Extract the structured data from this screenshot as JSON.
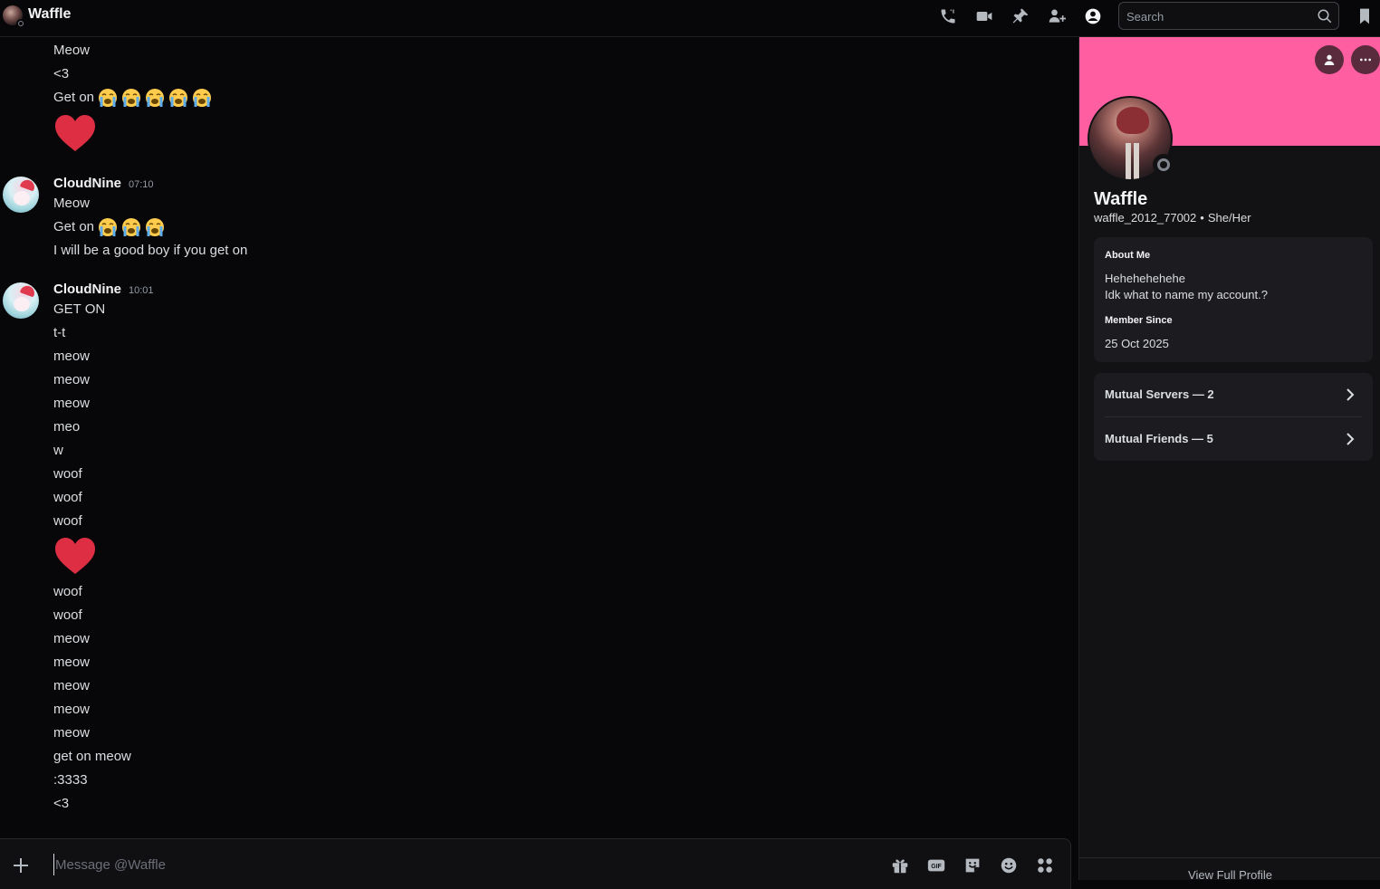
{
  "header": {
    "title": "Waffle",
    "icons": [
      "voice-call-icon",
      "video-call-icon",
      "pin-icon",
      "add-friends-icon",
      "user-profile-icon",
      "inbox-icon"
    ],
    "search_placeholder": "Search"
  },
  "messages": {
    "block0": {
      "lines": [
        "Meow",
        "<3",
        "Get on"
      ]
    },
    "block1": {
      "author": "CloudNine",
      "time": "07:10",
      "lines": [
        "Meow",
        "Get on",
        "I will be a good boy if you get on"
      ]
    },
    "block2": {
      "author": "CloudNine",
      "time": "10:01",
      "lines_a": [
        "GET ON",
        "t-t",
        "meow",
        "meow",
        "meow",
        "meo",
        "w",
        "woof",
        "woof",
        "woof"
      ],
      "lines_b": [
        "woof",
        "woof",
        "meow",
        "meow",
        "meow",
        "meow",
        "meow",
        "get on meow",
        ":3333",
        "<3"
      ]
    }
  },
  "composer": {
    "placeholder": "Message @Waffle",
    "icons": [
      "gift-icon",
      "gif-icon",
      "sticker-icon",
      "emoji-icon",
      "apps-icon"
    ]
  },
  "profile": {
    "banner_color": "#ff5fa0",
    "display_name": "Waffle",
    "username": "waffle_2012_77002",
    "separator": "•",
    "pronouns": "She/Her",
    "about_heading": "About Me",
    "about_line1": "Hehehehehehe",
    "about_line2": "Idk what to name my account.?",
    "member_heading": "Member Since",
    "member_since": "25 Oct 2025",
    "mutual_servers": "Mutual Servers — 2",
    "mutual_friends": "Mutual Friends — 5",
    "view_full": "View Full Profile"
  }
}
